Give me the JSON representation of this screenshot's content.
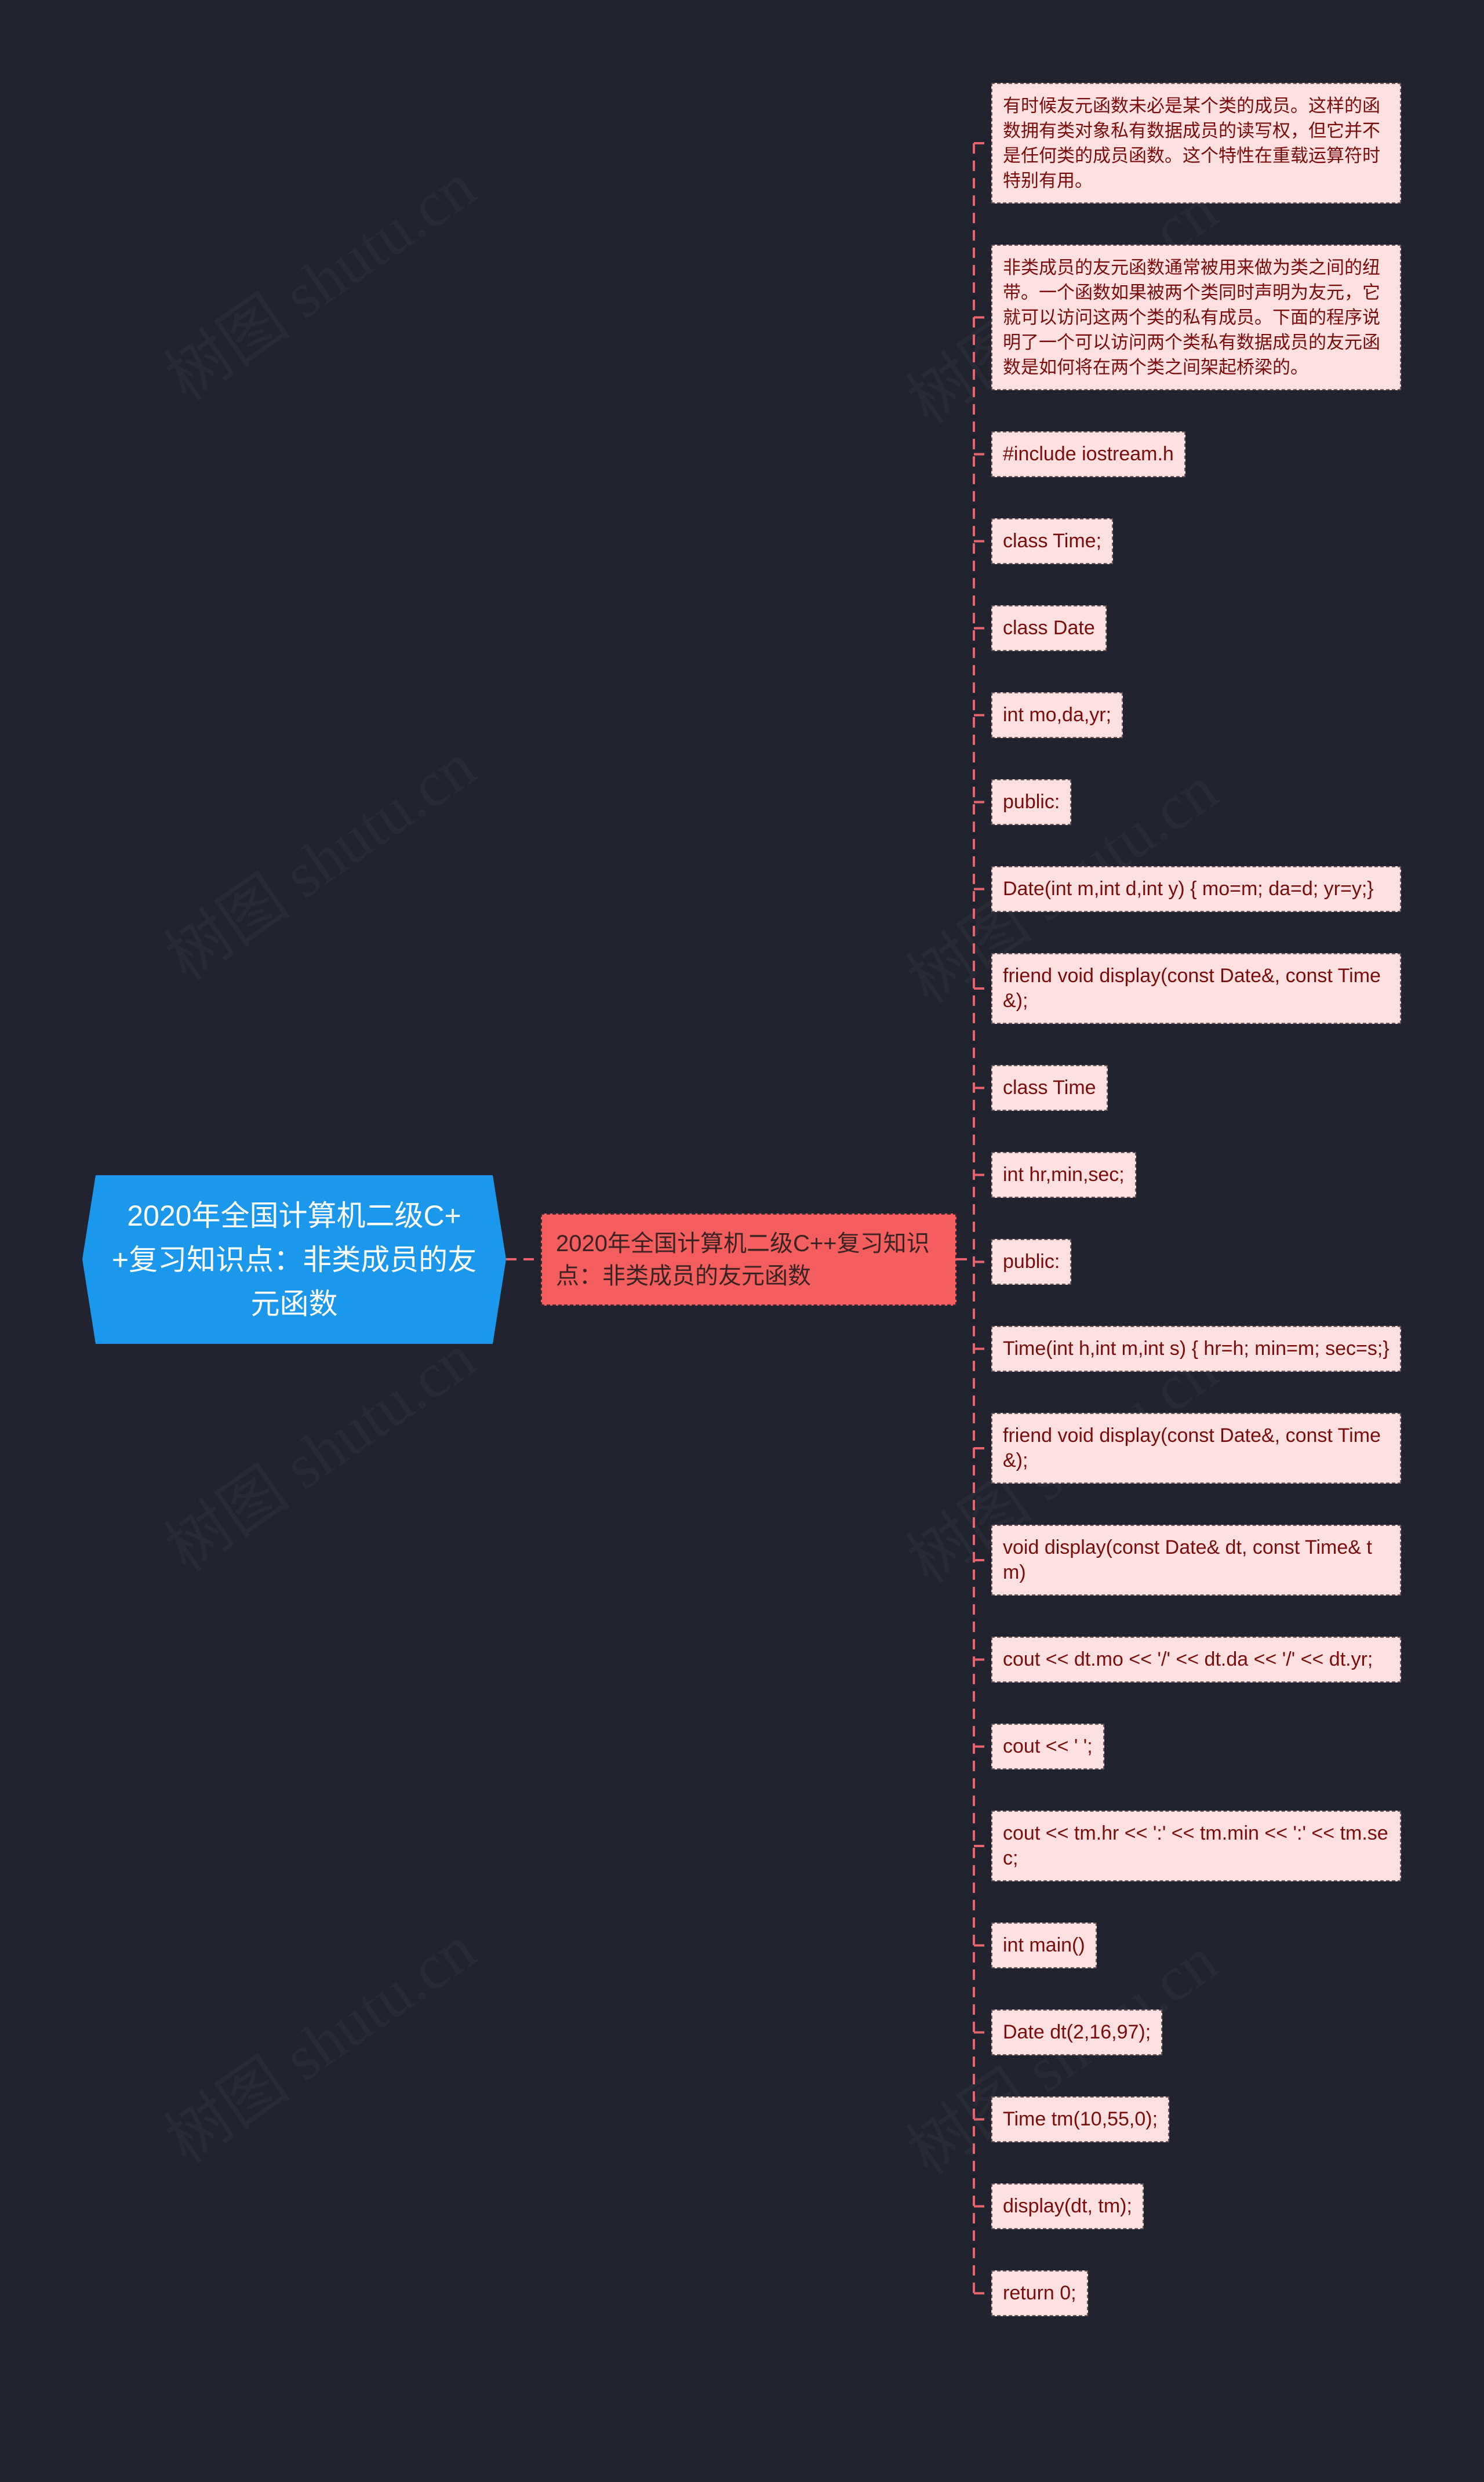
{
  "watermark": "树图 shutu.cn",
  "colors": {
    "background": "#212430",
    "root_fill": "#1b98ec",
    "root_text": "#ffffff",
    "branch_fill": "#f55e5e",
    "branch_text": "#3b2325",
    "leaf_fill": "#ffe0e0",
    "leaf_text": "#7a0c0c",
    "connector": "#e8646a"
  },
  "mindmap": {
    "root": {
      "label": "2020年全国计算机二级C++复习知识点：非类成员的友元函数"
    },
    "branch": {
      "label": "2020年全国计算机二级C++复习知识点：非类成员的友元函数"
    },
    "leaves": [
      {
        "label": "有时候友元函数未必是某个类的成员。这样的函数拥有类对象私有数据成员的读写权，但它并不是任何类的成员函数。这个特性在重载运算符时特别有用。",
        "kind": "text"
      },
      {
        "label": "非类成员的友元函数通常被用来做为类之间的纽带。一个函数如果被两个类同时声明为友元，它就可以访问这两个类的私有成员。下面的程序说明了一个可以访问两个类私有数据成员的友元函数是如何将在两个类之间架起桥梁的。",
        "kind": "text"
      },
      {
        "label": "#include iostream.h",
        "kind": "code"
      },
      {
        "label": "class Time;",
        "kind": "code"
      },
      {
        "label": "class Date",
        "kind": "code"
      },
      {
        "label": "int mo,da,yr;",
        "kind": "code"
      },
      {
        "label": "public:",
        "kind": "code"
      },
      {
        "label": "Date(int m,int d,int y) { mo=m; da=d; yr=y;}",
        "kind": "code"
      },
      {
        "label": "friend void display(const Date&, const Time&);",
        "kind": "code"
      },
      {
        "label": "class Time",
        "kind": "code"
      },
      {
        "label": "int hr,min,sec;",
        "kind": "code"
      },
      {
        "label": "public:",
        "kind": "code"
      },
      {
        "label": "Time(int h,int m,int s) { hr=h; min=m; sec=s;}",
        "kind": "code"
      },
      {
        "label": "friend void display(const Date&, const Time&);",
        "kind": "code"
      },
      {
        "label": "void display(const Date& dt, const Time& tm)",
        "kind": "code"
      },
      {
        "label": "cout << dt.mo << '/' << dt.da << '/' << dt.yr;",
        "kind": "code"
      },
      {
        "label": "cout << ' ';",
        "kind": "code"
      },
      {
        "label": "cout << tm.hr << ':' << tm.min << ':' << tm.sec;",
        "kind": "code"
      },
      {
        "label": "int main()",
        "kind": "code"
      },
      {
        "label": "Date dt(2,16,97);",
        "kind": "code"
      },
      {
        "label": "Time tm(10,55,0);",
        "kind": "code"
      },
      {
        "label": "display(dt, tm);",
        "kind": "code"
      },
      {
        "label": "return 0;",
        "kind": "code"
      }
    ]
  }
}
